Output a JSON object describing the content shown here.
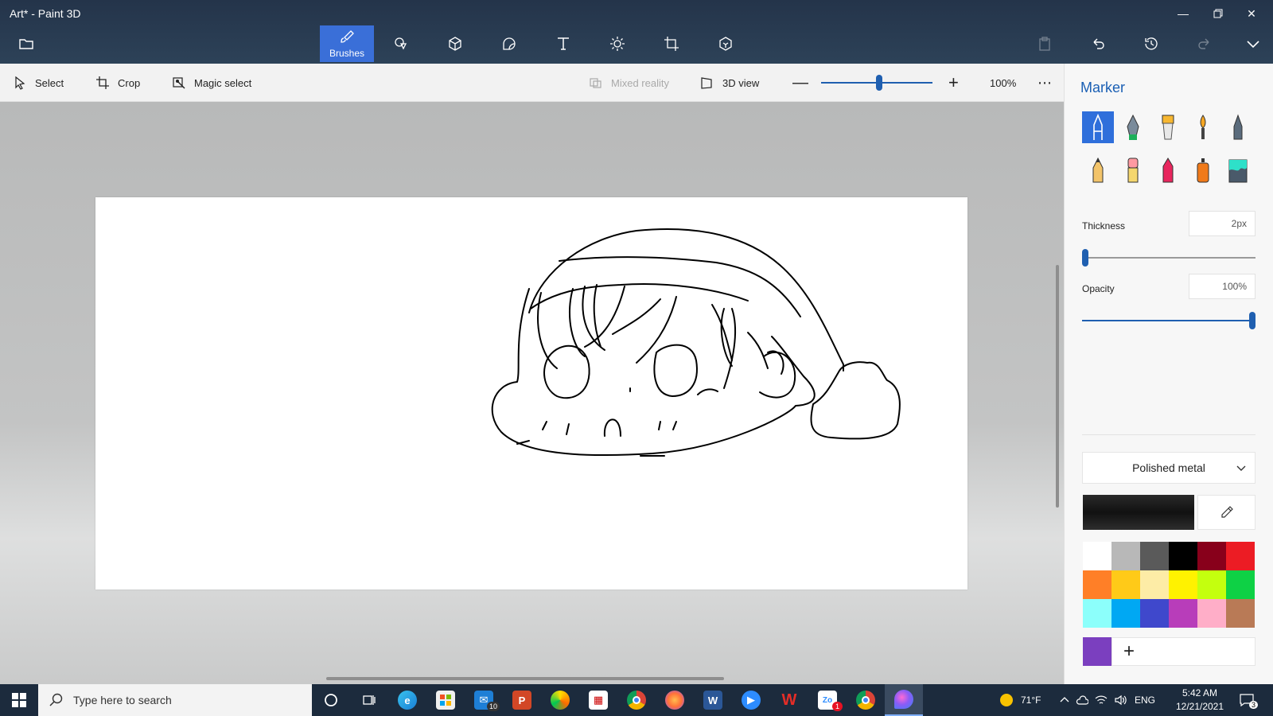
{
  "window": {
    "title": "Art* - Paint 3D"
  },
  "ribbon": {
    "active_tab_label": "Brushes",
    "tabs": [
      {
        "icon": "folder-icon"
      },
      {
        "icon": "brush-icon",
        "label": "Brushes"
      },
      {
        "icon": "2d-shapes-icon"
      },
      {
        "icon": "3d-shapes-icon"
      },
      {
        "icon": "stickers-icon"
      },
      {
        "icon": "text-icon"
      },
      {
        "icon": "effects-icon"
      },
      {
        "icon": "canvas-icon"
      },
      {
        "icon": "3d-library-icon"
      }
    ],
    "actions": [
      "paste-icon",
      "undo-icon",
      "history-icon",
      "redo-icon",
      "expand-icon"
    ]
  },
  "toolbar": {
    "select_label": "Select",
    "crop_label": "Crop",
    "magic_select_label": "Magic select",
    "mixed_reality_label": "Mixed reality",
    "view_3d_label": "3D view",
    "zoom_value": "100%",
    "zoom_level": 0.52
  },
  "panel": {
    "title": "Marker",
    "brushes": [
      {
        "name": "marker",
        "selected": true
      },
      {
        "name": "calligraphy-pen"
      },
      {
        "name": "oil-brush"
      },
      {
        "name": "watercolor"
      },
      {
        "name": "pixel-pen"
      },
      {
        "name": "pencil"
      },
      {
        "name": "eraser"
      },
      {
        "name": "crayon"
      },
      {
        "name": "spray-can"
      },
      {
        "name": "fill"
      }
    ],
    "thickness_label": "Thickness",
    "thickness_value": "2px",
    "thickness_level": 0.02,
    "opacity_label": "Opacity",
    "opacity_value": "100%",
    "opacity_level": 1.0,
    "finish_value": "Polished metal",
    "current_color": "#1a1a1a",
    "palette": [
      "#ffffff",
      "#b8b8b8",
      "#5a5a5a",
      "#000000",
      "#88001b",
      "#ec1c24",
      "#ff7f27",
      "#ffca18",
      "#fdeca6",
      "#fff200",
      "#c4ff0e",
      "#0ed145",
      "#8cfffb",
      "#00a8f3",
      "#3f48cc",
      "#b83dba",
      "#ffaec8",
      "#b97a56"
    ],
    "custom_color": "#7b3fbf",
    "add_color_label": "+"
  },
  "taskbar": {
    "search_placeholder": "Type here to search",
    "mail_badge": "10",
    "zoom_badge": "1",
    "weather": "71°F",
    "language": "ENG",
    "time": "5:42 AM",
    "date": "12/21/2021",
    "notification_count": "3"
  }
}
